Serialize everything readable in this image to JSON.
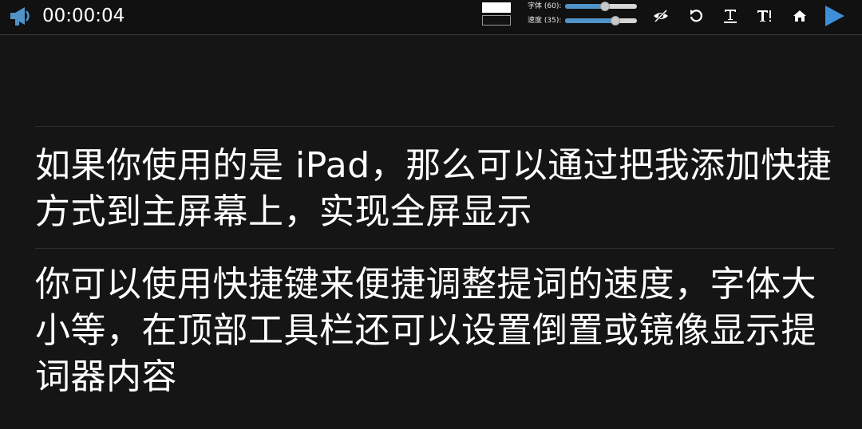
{
  "toolbar": {
    "timer": "00:00:04",
    "font_label": "字体 (60):",
    "font_value": 0.55,
    "speed_label": "速度 (35):",
    "speed_value": 0.7,
    "colors": {
      "accent": "#4f93c9",
      "text_color_swatch": "#ffffff",
      "background_color_swatch": "#111111"
    },
    "icons": [
      "megaphone-icon",
      "eye-off-icon",
      "reset-icon",
      "text-icon",
      "text-size-icon",
      "home-icon",
      "play-icon"
    ]
  },
  "script": {
    "paragraphs": [
      "如果你使用的是 iPad，那么可以通过把我添加快捷方式到主屏幕上，实现全屏显示",
      "你可以使用快捷键来便捷调整提词的速度，字体大小等，在顶部工具栏还可以设置倒置或镜像显示提词器内容"
    ]
  }
}
